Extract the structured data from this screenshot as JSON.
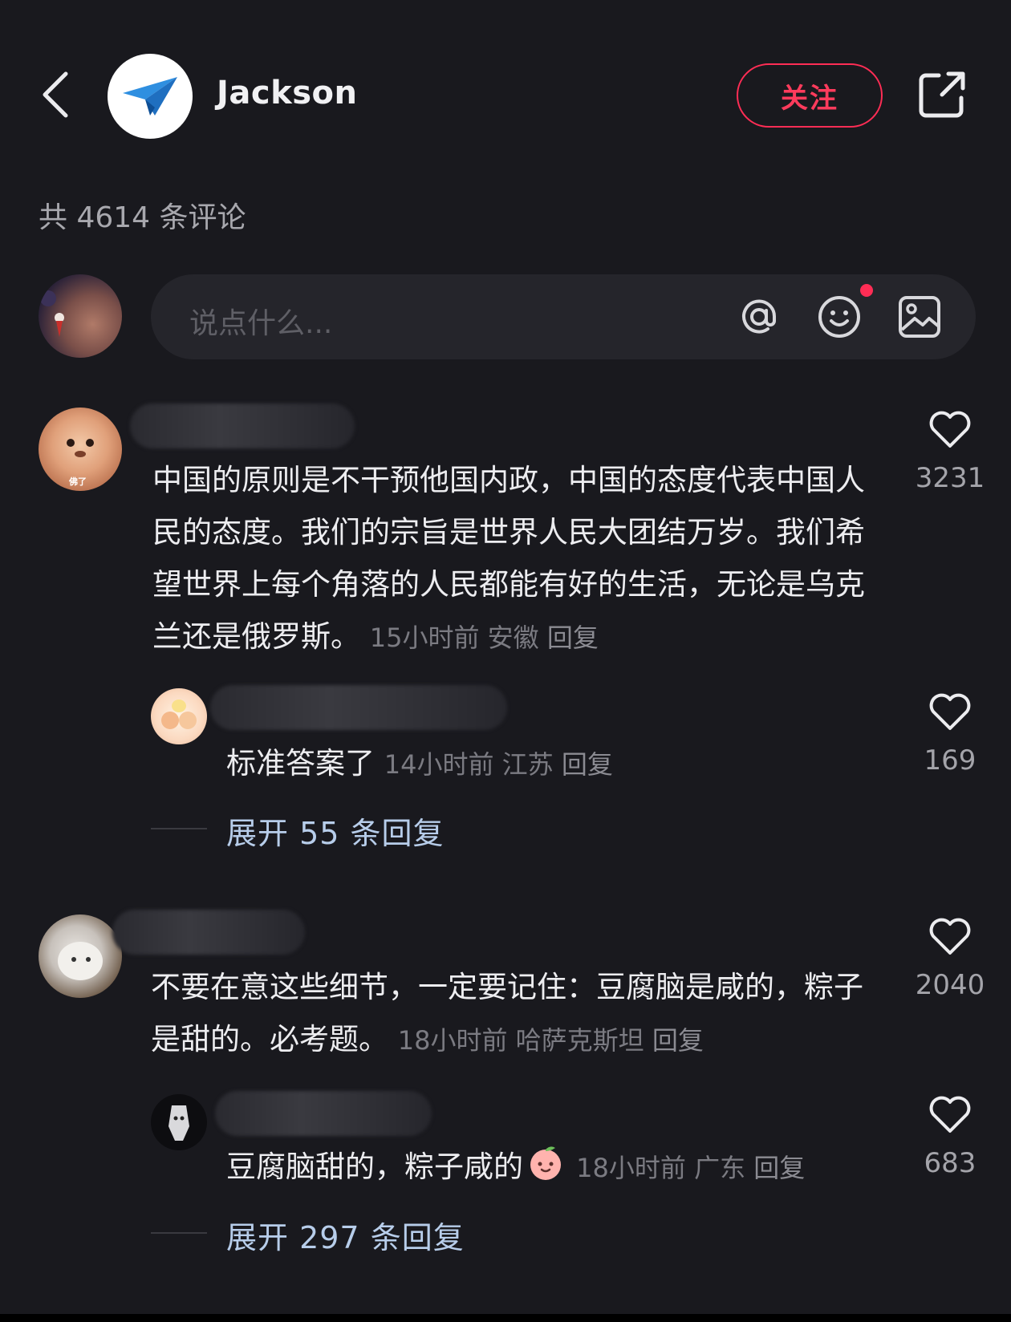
{
  "header": {
    "profile_name": "Jackson",
    "follow_label": "关注"
  },
  "comment_count_text": "共 4614 条评论",
  "input": {
    "placeholder": "说点什么..."
  },
  "colors": {
    "accent": "#ff2d55",
    "background": "#19191e",
    "link": "#b7cdea"
  },
  "comments": [
    {
      "text": "中国的原则是不干预他国内政，中国的态度代表中国人民的态度。我们的宗旨是世界人民大团结万岁。我们希望世界上每个角落的人民都能有好的生活，无论是乌克兰还是俄罗斯。",
      "time": "15小时前",
      "location": "安徽",
      "reply": "回复",
      "likes": "3231",
      "avatar_badge": "佛了",
      "sub_reply": {
        "text": "标准答案了",
        "time": "14小时前",
        "location": "江苏",
        "reply": "回复",
        "likes": "169"
      },
      "expand": "展开 55 条回复"
    },
    {
      "text": "不要在意这些细节，一定要记住：豆腐脑是咸的，粽子是甜的。必考题。",
      "time": "18小时前",
      "location": "哈萨克斯坦",
      "reply": "回复",
      "likes": "2040",
      "sub_reply": {
        "text": "豆腐脑甜的，粽子咸的",
        "time": "18小时前",
        "location": "广东",
        "reply": "回复",
        "likes": "683"
      },
      "expand": "展开 297 条回复"
    }
  ]
}
